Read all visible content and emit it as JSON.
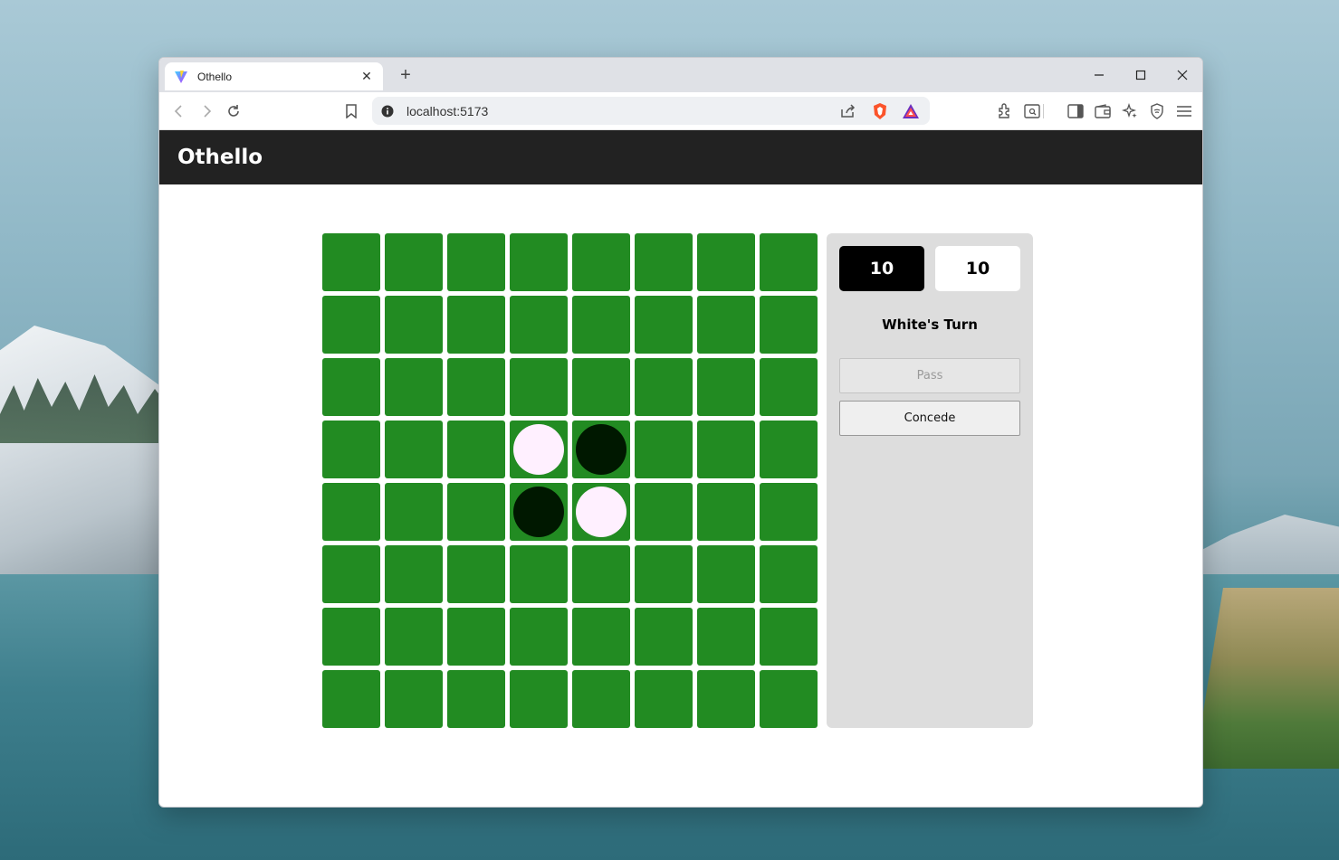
{
  "browser": {
    "tab_title": "Othello",
    "new_tab": "+",
    "address": "localhost:5173"
  },
  "app": {
    "title": "Othello"
  },
  "game": {
    "board": [
      [
        "",
        "",
        "",
        "",
        "",
        "",
        "",
        ""
      ],
      [
        "",
        "",
        "",
        "",
        "",
        "",
        "",
        ""
      ],
      [
        "",
        "",
        "",
        "",
        "",
        "",
        "",
        ""
      ],
      [
        "",
        "",
        "",
        "white",
        "black",
        "",
        "",
        ""
      ],
      [
        "",
        "",
        "",
        "black",
        "white",
        "",
        "",
        ""
      ],
      [
        "",
        "",
        "",
        "",
        "",
        "",
        "",
        ""
      ],
      [
        "",
        "",
        "",
        "",
        "",
        "",
        "",
        ""
      ],
      [
        "",
        "",
        "",
        "",
        "",
        "",
        "",
        ""
      ]
    ],
    "black_score": "10",
    "white_score": "10",
    "turn_label": "White's Turn",
    "pass_label": "Pass",
    "concede_label": "Concede"
  },
  "colors": {
    "board_green": "#228b22",
    "header_bg": "#222222",
    "panel_bg": "#dddddd"
  }
}
